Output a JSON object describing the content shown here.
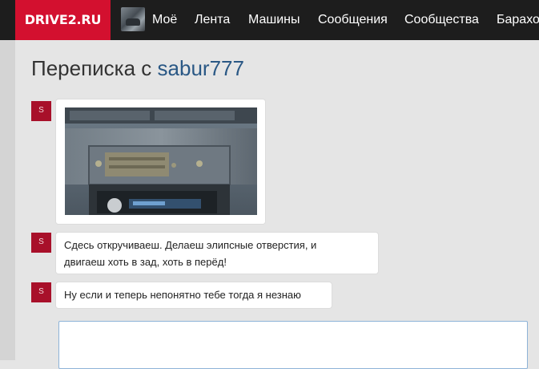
{
  "header": {
    "logo": "DRIVE2.RU",
    "nav": [
      "Моё",
      "Лента",
      "Машины",
      "Сообщения",
      "Сообщества",
      "Барахо"
    ]
  },
  "page": {
    "title_prefix": "Переписка с",
    "username": "sabur777"
  },
  "messages": [
    {
      "avatar_letter": "S",
      "type": "image",
      "image_alt": "photo"
    },
    {
      "avatar_letter": "S",
      "type": "text",
      "lines": [
        "Сдесь откручиваеш. Делаеш элипсные отверстия, и",
        "двигаеш хоть в зад, хоть в перёд!"
      ]
    },
    {
      "avatar_letter": "S",
      "type": "text",
      "lines": [
        "Ну если и теперь непонятно тебе тогда я незнаю"
      ]
    }
  ],
  "reply": {
    "value": "",
    "placeholder": ""
  },
  "colors": {
    "brand": "#d3102f",
    "topbar": "#1d1d1d",
    "link": "#2a5885",
    "avatar": "#a8102a"
  }
}
